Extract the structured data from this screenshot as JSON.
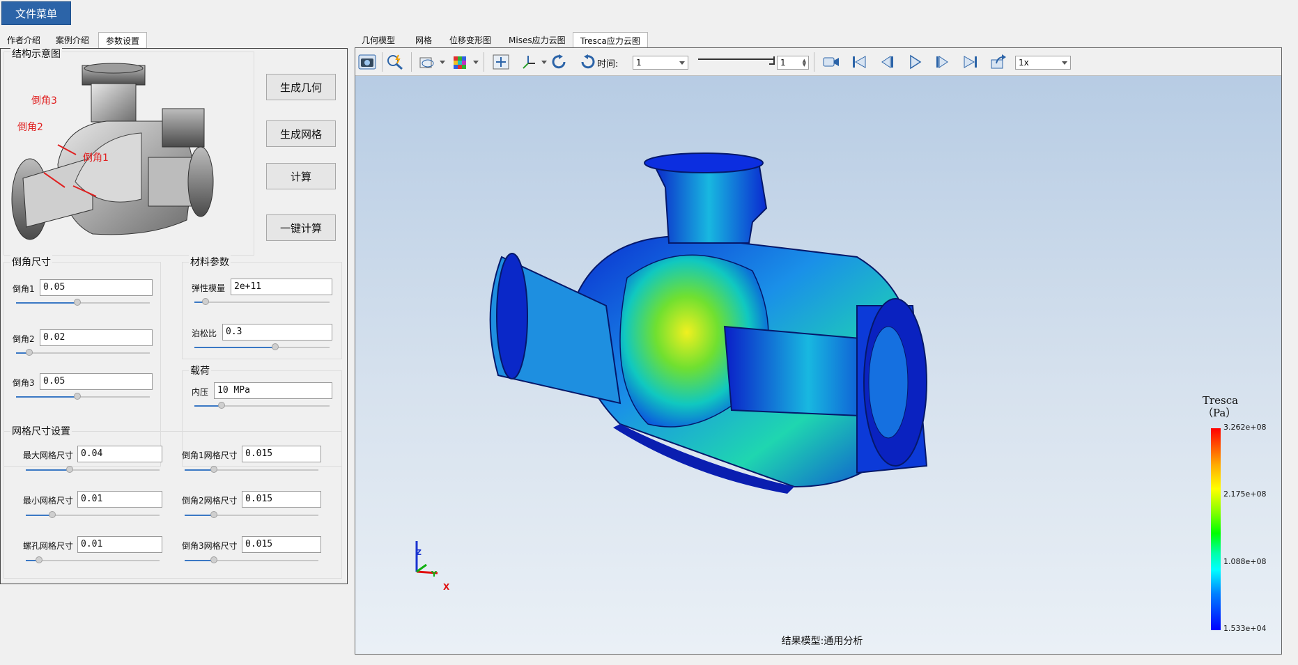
{
  "menu": {
    "file_menu": "文件菜单"
  },
  "left_tabs": [
    "作者介绍",
    "案例介绍",
    "参数设置"
  ],
  "left_active_tab": 2,
  "right_tabs": [
    "几何模型",
    "网格",
    "位移变形图",
    "Mises应力云图",
    "Tresca应力云图"
  ],
  "right_active_tab": 4,
  "schematic": {
    "title": "结构示意图",
    "labels": [
      "倒角3",
      "倒角2",
      "倒角1"
    ]
  },
  "buttons": {
    "gen_geometry": "生成几何",
    "gen_mesh": "生成网格",
    "compute": "计算",
    "one_click": "一键计算"
  },
  "chamfer": {
    "title": "倒角尺寸",
    "fields": [
      {
        "label": "倒角1",
        "value": "0.05",
        "slider": 0.46
      },
      {
        "label": "倒角2",
        "value": "0.02",
        "slider": 0.1
      },
      {
        "label": "倒角3",
        "value": "0.05",
        "slider": 0.46
      }
    ]
  },
  "material": {
    "title": "材料参数",
    "fields": [
      {
        "label": "弹性模量",
        "value": "2e+11",
        "slider": 0.08
      },
      {
        "label": "泊松比",
        "value": "0.3",
        "slider": 0.6
      }
    ]
  },
  "load": {
    "title": "载荷",
    "fields": [
      {
        "label": "内压",
        "value": "10 MPa",
        "slider": 0.2
      }
    ]
  },
  "mesh": {
    "title": "网格尺寸设置",
    "fields": [
      {
        "label": "最大网格尺寸",
        "value": "0.04",
        "slider": 0.33
      },
      {
        "label": "最小网格尺寸",
        "value": "0.01",
        "slider": 0.2
      },
      {
        "label": "螺孔网格尺寸",
        "value": "0.01",
        "slider": 0.1
      },
      {
        "label": "倒角1网格尺寸",
        "value": "0.015",
        "slider": 0.22
      },
      {
        "label": "倒角2网格尺寸",
        "value": "0.015",
        "slider": 0.22
      },
      {
        "label": "倒角3网格尺寸",
        "value": "0.015",
        "slider": 0.22
      }
    ]
  },
  "toolbar": {
    "time_label": "时间:",
    "time_value": "1",
    "frame_value": "1",
    "speed_value": "1x",
    "icons": [
      "camera-icon",
      "zoom-icon",
      "display-style-icon",
      "color-map-icon",
      "fit-view-icon",
      "axes-icon",
      "rotate-cw-icon",
      "rotate-ccw-icon",
      "record-icon",
      "first-frame-icon",
      "prev-frame-icon",
      "play-icon",
      "next-frame-icon",
      "last-frame-icon",
      "export-icon"
    ]
  },
  "legend": {
    "title_line1": "Tresca",
    "title_line2": "（Pa）",
    "max": "3.262e+08",
    "v2": "2.175e+08",
    "v3": "1.088e+08",
    "min": "1.533e+04"
  },
  "axes_labels": {
    "z": "Z",
    "y": "Y",
    "x": "X"
  },
  "result_model": "结果模型:通用分析",
  "colors": {
    "menu_blue": "#2c64a8",
    "slider_blue": "#3a78c4",
    "label_red": "#e02020"
  }
}
